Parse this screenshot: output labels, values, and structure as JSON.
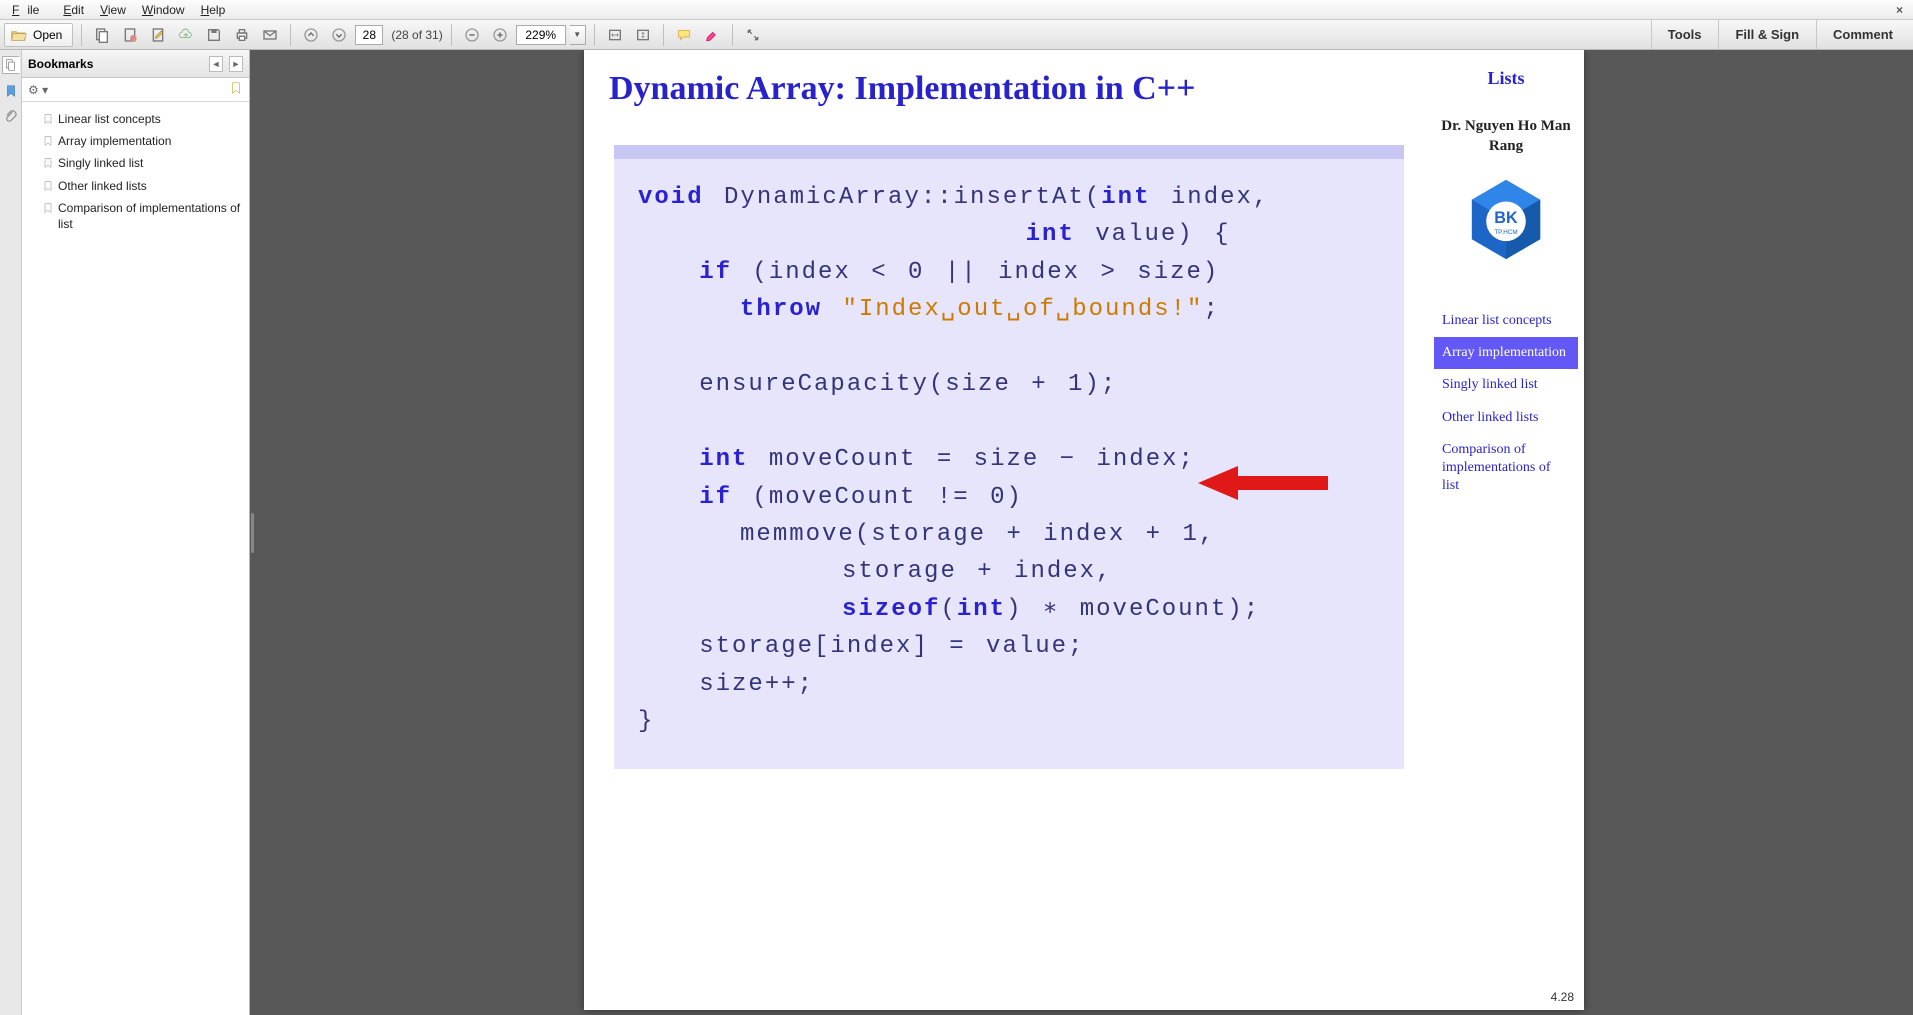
{
  "menubar": {
    "items": [
      "File",
      "Edit",
      "View",
      "Window",
      "Help"
    ]
  },
  "toolbar": {
    "open_label": "Open",
    "page_current": "28",
    "page_count": "(28 of 31)",
    "zoom": "229%",
    "right_tabs": [
      "Tools",
      "Fill & Sign",
      "Comment"
    ]
  },
  "bookmarks_panel": {
    "title": "Bookmarks",
    "items": [
      "Linear list concepts",
      "Array implementation",
      "Singly linked list",
      "Other linked lists",
      "Comparison of implementations of list"
    ]
  },
  "slide": {
    "title": "Dynamic Array: Implementation in C++",
    "page_number": "4.28",
    "code": {
      "l1a": "void",
      "l1b": " DynamicArray::insertAt(",
      "l1c": "int",
      "l1d": " index,",
      "l2a": "                   ",
      "l2b": "int",
      "l2c": " value) {",
      "l3a": "   ",
      "l3b": "if",
      "l3c": " (index < 0 || index > size)",
      "l4a": "     ",
      "l4b": "throw",
      "l4c": " ",
      "l4d": "\"Index␣out␣of␣bounds!\"",
      "l4e": ";",
      "l5": "",
      "l6": "   ensureCapacity(size + 1);",
      "l7": "",
      "l8a": "   ",
      "l8b": "int",
      "l8c": " moveCount = size − index;",
      "l9a": "   ",
      "l9b": "if",
      "l9c": " (moveCount != 0)",
      "l10": "     memmove(storage + index + 1,",
      "l11": "          storage + index,",
      "l12a": "          ",
      "l12b": "sizeof",
      "l12c": "(",
      "l12d": "int",
      "l12e": ") ∗ moveCount);",
      "l13": "   storage[index] = value;",
      "l14": "   size++;",
      "l15": "}"
    },
    "right": {
      "title": "Lists",
      "author": "Dr. Nguyen Ho Man Rang",
      "logo_text": "BK",
      "logo_sub": "TP.HCM",
      "nav": [
        "Linear list concepts",
        "Array implementation",
        "Singly linked list",
        "Other linked lists",
        "Comparison of implementations of list"
      ],
      "active_index": 1
    }
  }
}
